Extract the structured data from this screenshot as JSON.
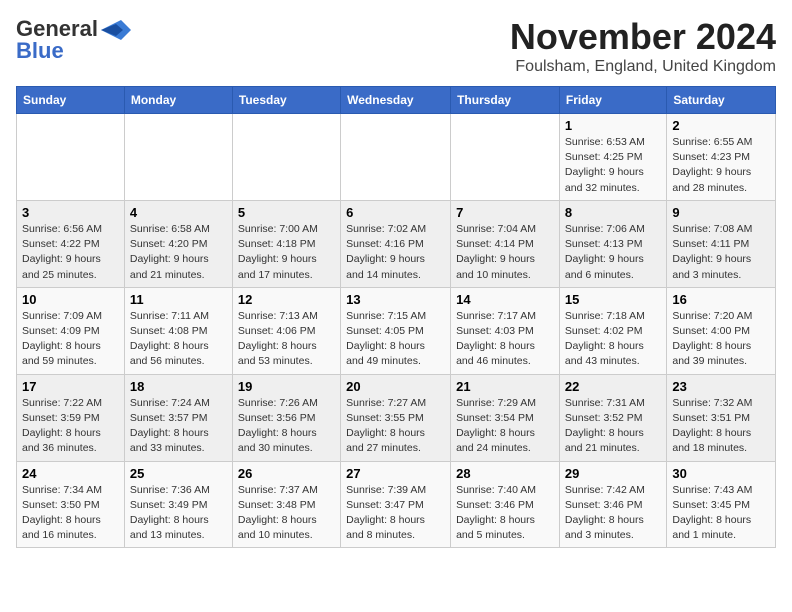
{
  "logo": {
    "line1": "General",
    "line2": "Blue"
  },
  "title": "November 2024",
  "location": "Foulsham, England, United Kingdom",
  "days_of_week": [
    "Sunday",
    "Monday",
    "Tuesday",
    "Wednesday",
    "Thursday",
    "Friday",
    "Saturday"
  ],
  "weeks": [
    [
      {
        "day": "",
        "info": ""
      },
      {
        "day": "",
        "info": ""
      },
      {
        "day": "",
        "info": ""
      },
      {
        "day": "",
        "info": ""
      },
      {
        "day": "",
        "info": ""
      },
      {
        "day": "1",
        "info": "Sunrise: 6:53 AM\nSunset: 4:25 PM\nDaylight: 9 hours and 32 minutes."
      },
      {
        "day": "2",
        "info": "Sunrise: 6:55 AM\nSunset: 4:23 PM\nDaylight: 9 hours and 28 minutes."
      }
    ],
    [
      {
        "day": "3",
        "info": "Sunrise: 6:56 AM\nSunset: 4:22 PM\nDaylight: 9 hours and 25 minutes."
      },
      {
        "day": "4",
        "info": "Sunrise: 6:58 AM\nSunset: 4:20 PM\nDaylight: 9 hours and 21 minutes."
      },
      {
        "day": "5",
        "info": "Sunrise: 7:00 AM\nSunset: 4:18 PM\nDaylight: 9 hours and 17 minutes."
      },
      {
        "day": "6",
        "info": "Sunrise: 7:02 AM\nSunset: 4:16 PM\nDaylight: 9 hours and 14 minutes."
      },
      {
        "day": "7",
        "info": "Sunrise: 7:04 AM\nSunset: 4:14 PM\nDaylight: 9 hours and 10 minutes."
      },
      {
        "day": "8",
        "info": "Sunrise: 7:06 AM\nSunset: 4:13 PM\nDaylight: 9 hours and 6 minutes."
      },
      {
        "day": "9",
        "info": "Sunrise: 7:08 AM\nSunset: 4:11 PM\nDaylight: 9 hours and 3 minutes."
      }
    ],
    [
      {
        "day": "10",
        "info": "Sunrise: 7:09 AM\nSunset: 4:09 PM\nDaylight: 8 hours and 59 minutes."
      },
      {
        "day": "11",
        "info": "Sunrise: 7:11 AM\nSunset: 4:08 PM\nDaylight: 8 hours and 56 minutes."
      },
      {
        "day": "12",
        "info": "Sunrise: 7:13 AM\nSunset: 4:06 PM\nDaylight: 8 hours and 53 minutes."
      },
      {
        "day": "13",
        "info": "Sunrise: 7:15 AM\nSunset: 4:05 PM\nDaylight: 8 hours and 49 minutes."
      },
      {
        "day": "14",
        "info": "Sunrise: 7:17 AM\nSunset: 4:03 PM\nDaylight: 8 hours and 46 minutes."
      },
      {
        "day": "15",
        "info": "Sunrise: 7:18 AM\nSunset: 4:02 PM\nDaylight: 8 hours and 43 minutes."
      },
      {
        "day": "16",
        "info": "Sunrise: 7:20 AM\nSunset: 4:00 PM\nDaylight: 8 hours and 39 minutes."
      }
    ],
    [
      {
        "day": "17",
        "info": "Sunrise: 7:22 AM\nSunset: 3:59 PM\nDaylight: 8 hours and 36 minutes."
      },
      {
        "day": "18",
        "info": "Sunrise: 7:24 AM\nSunset: 3:57 PM\nDaylight: 8 hours and 33 minutes."
      },
      {
        "day": "19",
        "info": "Sunrise: 7:26 AM\nSunset: 3:56 PM\nDaylight: 8 hours and 30 minutes."
      },
      {
        "day": "20",
        "info": "Sunrise: 7:27 AM\nSunset: 3:55 PM\nDaylight: 8 hours and 27 minutes."
      },
      {
        "day": "21",
        "info": "Sunrise: 7:29 AM\nSunset: 3:54 PM\nDaylight: 8 hours and 24 minutes."
      },
      {
        "day": "22",
        "info": "Sunrise: 7:31 AM\nSunset: 3:52 PM\nDaylight: 8 hours and 21 minutes."
      },
      {
        "day": "23",
        "info": "Sunrise: 7:32 AM\nSunset: 3:51 PM\nDaylight: 8 hours and 18 minutes."
      }
    ],
    [
      {
        "day": "24",
        "info": "Sunrise: 7:34 AM\nSunset: 3:50 PM\nDaylight: 8 hours and 16 minutes."
      },
      {
        "day": "25",
        "info": "Sunrise: 7:36 AM\nSunset: 3:49 PM\nDaylight: 8 hours and 13 minutes."
      },
      {
        "day": "26",
        "info": "Sunrise: 7:37 AM\nSunset: 3:48 PM\nDaylight: 8 hours and 10 minutes."
      },
      {
        "day": "27",
        "info": "Sunrise: 7:39 AM\nSunset: 3:47 PM\nDaylight: 8 hours and 8 minutes."
      },
      {
        "day": "28",
        "info": "Sunrise: 7:40 AM\nSunset: 3:46 PM\nDaylight: 8 hours and 5 minutes."
      },
      {
        "day": "29",
        "info": "Sunrise: 7:42 AM\nSunset: 3:46 PM\nDaylight: 8 hours and 3 minutes."
      },
      {
        "day": "30",
        "info": "Sunrise: 7:43 AM\nSunset: 3:45 PM\nDaylight: 8 hours and 1 minute."
      }
    ]
  ]
}
